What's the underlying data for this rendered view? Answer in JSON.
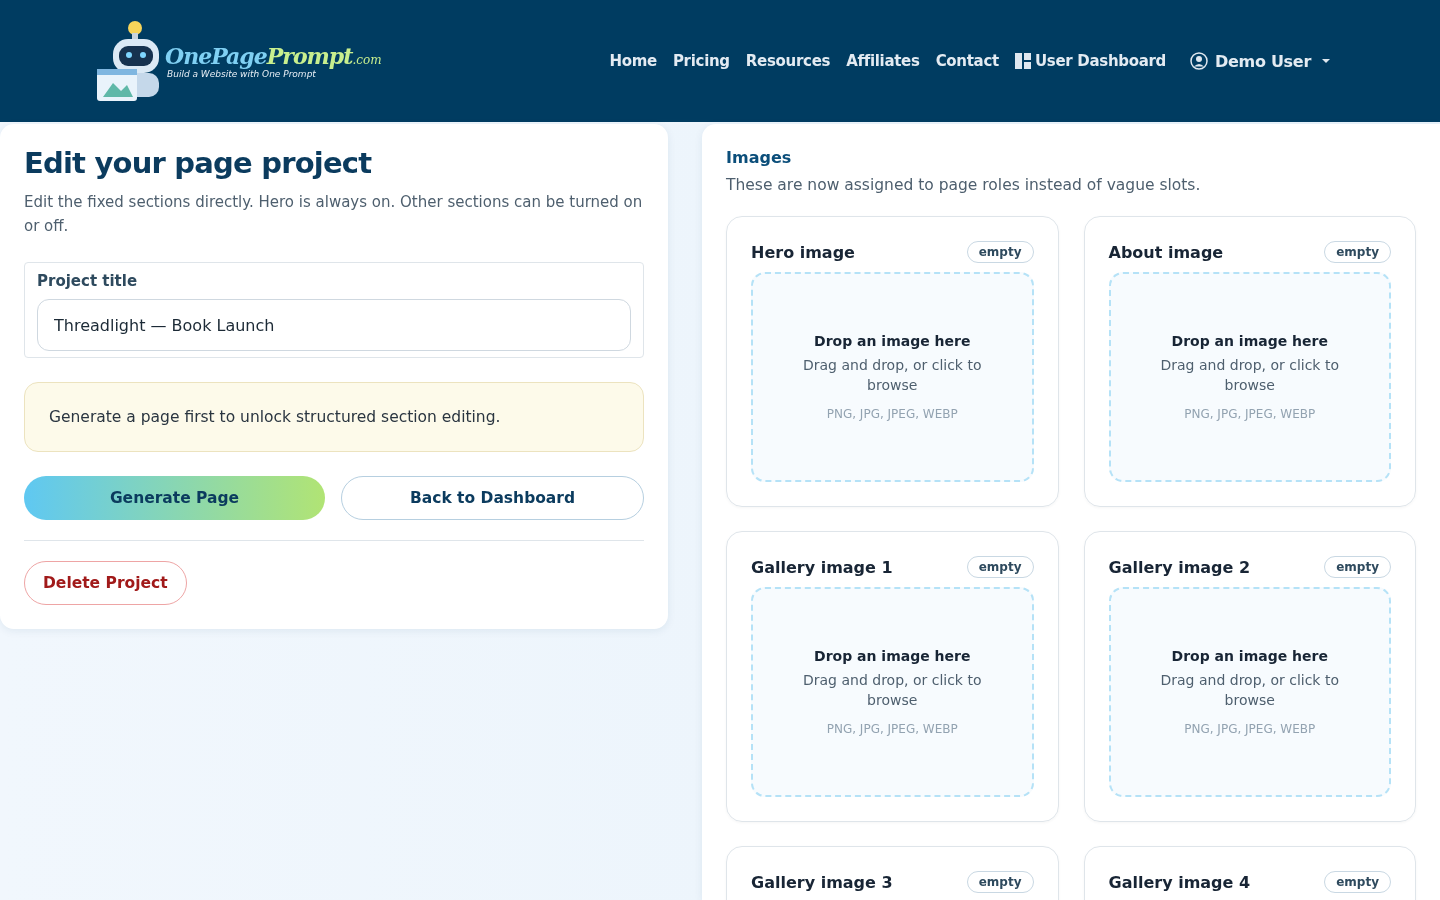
{
  "header": {
    "logo": {
      "name_a": "OnePage",
      "name_b": "Prompt",
      "suffix": ".com",
      "tagline": "Build a Website with One Prompt"
    },
    "nav": [
      {
        "label": "Home",
        "kind": "link"
      },
      {
        "label": "Pricing",
        "kind": "link"
      },
      {
        "label": "Resources",
        "kind": "link"
      },
      {
        "label": "Affiliates",
        "kind": "link"
      },
      {
        "label": "Contact",
        "kind": "link"
      },
      {
        "label": "User Dashboard",
        "kind": "dashboard"
      }
    ],
    "user": {
      "name": "Demo User"
    }
  },
  "editor": {
    "title": "Edit your page project",
    "description": "Edit the fixed sections directly. Hero is always on. Other sections can be turned on or off.",
    "project_title": {
      "label": "Project title",
      "value": "Threadlight — Book Launch"
    },
    "notice": "Generate a page first to unlock structured section editing.",
    "buttons": [
      {
        "label": "Generate Page",
        "kind": "primary"
      },
      {
        "label": "Back to Dashboard",
        "kind": "outline"
      }
    ],
    "delete_button": "Delete Project"
  },
  "images": {
    "heading": "Images",
    "description": "These are now assigned to page roles instead of vague slots.",
    "slots": [
      {
        "title": "Hero image",
        "badge": "empty",
        "drop_title": "Drop an image here",
        "drop_hint": "Drag and drop, or click to browse",
        "formats": "PNG, JPG, JPEG, WEBP"
      },
      {
        "title": "About image",
        "badge": "empty",
        "drop_title": "Drop an image here",
        "drop_hint": "Drag and drop, or click to browse",
        "formats": "PNG, JPG, JPEG, WEBP"
      },
      {
        "title": "Gallery image 1",
        "badge": "empty",
        "drop_title": "Drop an image here",
        "drop_hint": "Drag and drop, or click to browse",
        "formats": "PNG, JPG, JPEG, WEBP"
      },
      {
        "title": "Gallery image 2",
        "badge": "empty",
        "drop_title": "Drop an image here",
        "drop_hint": "Drag and drop, or click to browse",
        "formats": "PNG, JPG, JPEG, WEBP"
      },
      {
        "title": "Gallery image 3",
        "badge": "empty"
      },
      {
        "title": "Gallery image 4",
        "badge": "empty"
      }
    ]
  }
}
